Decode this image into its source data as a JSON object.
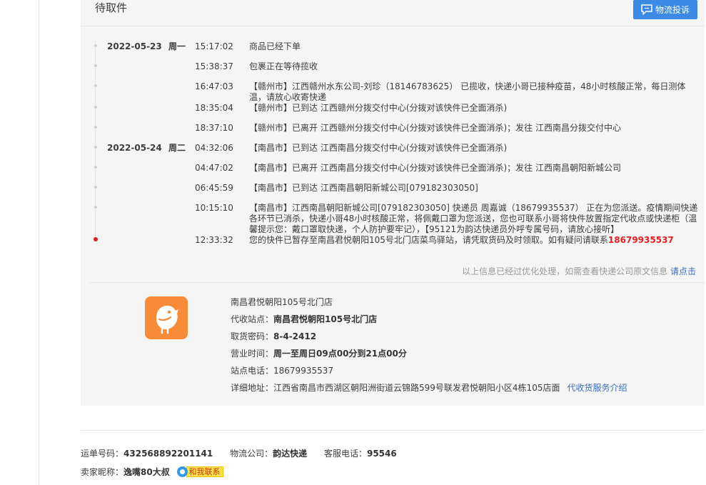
{
  "panel": {
    "title": "待取件",
    "complain_button": "物流投诉"
  },
  "timeline": {
    "events": [
      {
        "date": "2022-05-23",
        "weekday": "周一",
        "time": "15:17:02",
        "text": "商品已经下单"
      },
      {
        "date": "",
        "weekday": "",
        "time": "15:38:37",
        "text": "包裹正在等待揽收"
      },
      {
        "date": "",
        "weekday": "",
        "time": "16:47:03",
        "text": "【赣州市】江西赣州水东公司-刘珍（18146783625） 已揽收，快递小哥已接种疫苗，48小时核酸正常，每日测体温，请放心收寄快递"
      },
      {
        "date": "",
        "weekday": "",
        "time": "18:35:04",
        "text": "【赣州市】已到达 江西赣州分拨交付中心(分拨对该快件已全面消杀)"
      },
      {
        "date": "",
        "weekday": "",
        "time": "18:37:10",
        "text": "【赣州市】已离开 江西赣州分拨交付中心(分拨对该快件已全面消杀)；发往 江西南昌分拨交付中心"
      },
      {
        "date": "2022-05-24",
        "weekday": "周二",
        "time": "04:32:06",
        "text": "【南昌市】已到达 江西南昌分拨交付中心(分拨对该快件已全面消杀)"
      },
      {
        "date": "",
        "weekday": "",
        "time": "04:47:02",
        "text": "【南昌市】已离开 江西南昌分拨交付中心(分拨对该快件已全面消杀)；发往 江西南昌朝阳新城公司"
      },
      {
        "date": "",
        "weekday": "",
        "time": "06:45:59",
        "text": "【南昌市】已到达 江西南昌朝阳新城公司[079182303050]"
      },
      {
        "date": "",
        "weekday": "",
        "time": "10:15:10",
        "text": "【南昌市】江西南昌朝阳新城公司[079182303050] 快递员 周嘉诚（18679935537） 正在为您派送。疫情期间快递各环节已消杀，快递小哥48小时核酸正常，将佩戴口罩为您派送，您也可联系小哥将快件放置指定代收点或快递柜（温馨提示您：戴口罩取快递，个人防护要牢记），【95121为韵达快递员外呼专属号码，请放心接听】"
      },
      {
        "date": "",
        "weekday": "",
        "time": "12:33:32",
        "text": "您的快件已暂存至南昌君悦朝阳105号北门店菜鸟驿站，请凭取货码及时领取。如有疑问请联系",
        "phone": "18679935537"
      }
    ],
    "note_text": "以上信息已经过优化处理，如需查看快递公司原文信息 ",
    "note_link": "请点击"
  },
  "station": {
    "name": "南昌君悦朝阳105号北门店",
    "agent_label": "代收站点：",
    "agent_value": "南昌君悦朝阳105号北门店",
    "code_label": "取货密码：",
    "code_value": "8-4-2412",
    "hours_label": "营业时间：",
    "hours_value": "周一至周日09点00分到21点00分",
    "phone_label": "站点电话：",
    "phone_value": "18679935537",
    "address_label": "详细地址：",
    "address_value": "江西省南昌市西湖区朝阳洲街道云锦路599号联发君悦朝阳小区4栋105店面",
    "service_link": "代收货服务介绍"
  },
  "footer": {
    "waybill_label": "运单号码：",
    "waybill_value": "432568892201141",
    "company_label": "物流公司：",
    "company_value": "韵达快递",
    "hotline_label": "客服电话：",
    "hotline_value": "95546",
    "seller_label": "卖家昵称：",
    "seller_value": "逸嘴80大叔",
    "contact_label": "和我联系"
  },
  "colors": {
    "accent": "#3b8ae6",
    "highlight": "#e02020",
    "station_logo": "#f88b38"
  }
}
